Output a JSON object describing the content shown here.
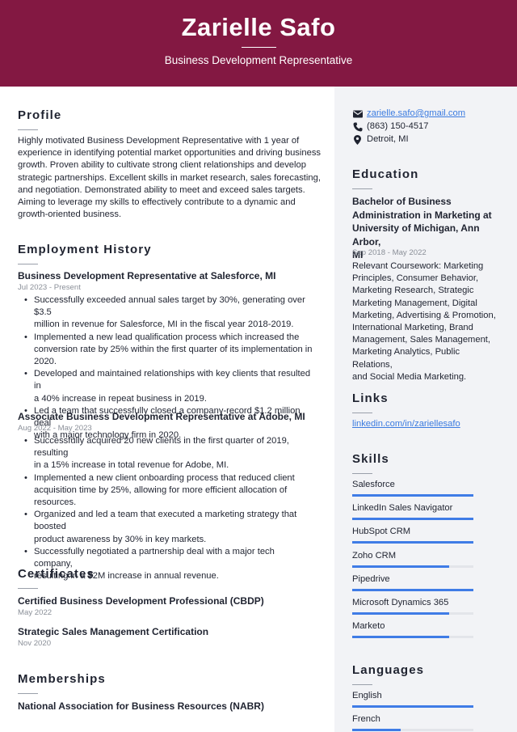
{
  "header": {
    "name": "Zarielle Safo",
    "title": "Business Development Representative"
  },
  "contact": {
    "email": "zarielle.safo@gmail.com",
    "phone": "(863) 150-4517",
    "location": "Detroit, MI",
    "icons": [
      "envelope-icon",
      "phone-icon",
      "location-pin-icon"
    ]
  },
  "profile": {
    "heading": "Profile",
    "lines": [
      "Highly motivated Business Development Representative with 1 year of",
      "experience in identifying potential market opportunities and driving business",
      "growth. Proven ability to cultivate strong client relationships and develop",
      "strategic partnerships. Excellent skills in market research, sales forecasting,",
      "and negotiation. Demonstrated ability to meet and exceed sales targets.",
      "Aiming to leverage my skills to effectively contribute to a dynamic and",
      "growth-oriented business."
    ]
  },
  "employment": {
    "heading": "Employment History",
    "jobs": [
      {
        "title": "Business Development Representative at Salesforce, MI",
        "dates": "Jul 2023 - Present",
        "bullets": [
          [
            "Successfully exceeded annual sales target by 30%, generating over $3.5",
            "million in revenue for Salesforce, MI in the fiscal year 2018-2019."
          ],
          [
            "Implemented a new lead qualification process which increased the",
            "conversion rate by 25% within the first quarter of its implementation in",
            "2020."
          ],
          [
            "Developed and maintained relationships with key clients that resulted in",
            "a 40% increase in repeat business in 2019."
          ],
          [
            "Led a team that successfully closed a company-record $1.2 million deal",
            "with a major technology firm in 2020."
          ]
        ]
      },
      {
        "title": "Associate Business Development Representative at Adobe, MI",
        "dates": "Aug 2022 - May 2023",
        "bullets": [
          [
            "Successfully acquired 20 new clients in the first quarter of 2019, resulting",
            "in a 15% increase in total revenue for Adobe, MI."
          ],
          [
            "Implemented a new client onboarding process that reduced client",
            "acquisition time by 25%, allowing for more efficient allocation of",
            "resources."
          ],
          [
            "Organized and led a team that executed a marketing strategy that boosted",
            "product awareness by 30% in key markets."
          ],
          [
            "Successfully negotiated a partnership deal with a major tech company,",
            "resulting in a $2M increase in annual revenue."
          ]
        ]
      }
    ]
  },
  "certificates": {
    "heading": "Certificates",
    "items": [
      {
        "name": "Certified Business Development Professional (CBDP)",
        "date": "May 2022"
      },
      {
        "name": "Strategic Sales Management Certification",
        "date": "Nov 2020"
      }
    ]
  },
  "memberships": {
    "heading": "Memberships",
    "items": [
      "National Association for Business Resources (NABR)"
    ]
  },
  "education": {
    "heading": "Education",
    "degree_lines": [
      "Bachelor of Business",
      "Administration in Marketing at",
      "University of Michigan, Ann Arbor,",
      "MI"
    ],
    "dates": "Sep 2018 - May 2022",
    "coursework_lines": [
      "Relevant Coursework: Marketing",
      "Principles, Consumer Behavior,",
      "Marketing Research, Strategic",
      "Marketing Management, Digital",
      "Marketing, Advertising & Promotion,",
      "International Marketing, Brand",
      "Management, Sales Management,",
      "Marketing Analytics, Public Relations,",
      "and Social Media Marketing."
    ]
  },
  "links": {
    "heading": "Links",
    "items": [
      "linkedin.com/in/zariellesafo"
    ]
  },
  "skills": {
    "heading": "Skills",
    "items": [
      {
        "name": "Salesforce",
        "level": 1.0
      },
      {
        "name": "LinkedIn Sales Navigator",
        "level": 1.0
      },
      {
        "name": "HubSpot CRM",
        "level": 1.0
      },
      {
        "name": "Zoho CRM",
        "level": 0.8
      },
      {
        "name": "Pipedrive",
        "level": 1.0
      },
      {
        "name": "Microsoft Dynamics 365",
        "level": 0.8
      },
      {
        "name": "Marketo",
        "level": 0.8
      }
    ]
  },
  "languages": {
    "heading": "Languages",
    "items": [
      {
        "name": "English",
        "level": 1.0
      },
      {
        "name": "French",
        "level": 0.4
      }
    ]
  },
  "colors": {
    "header_bg": "#831842",
    "accent": "#3f7ce6",
    "sidebar_bg": "#f2f3f6",
    "link": "#3b7be0"
  }
}
